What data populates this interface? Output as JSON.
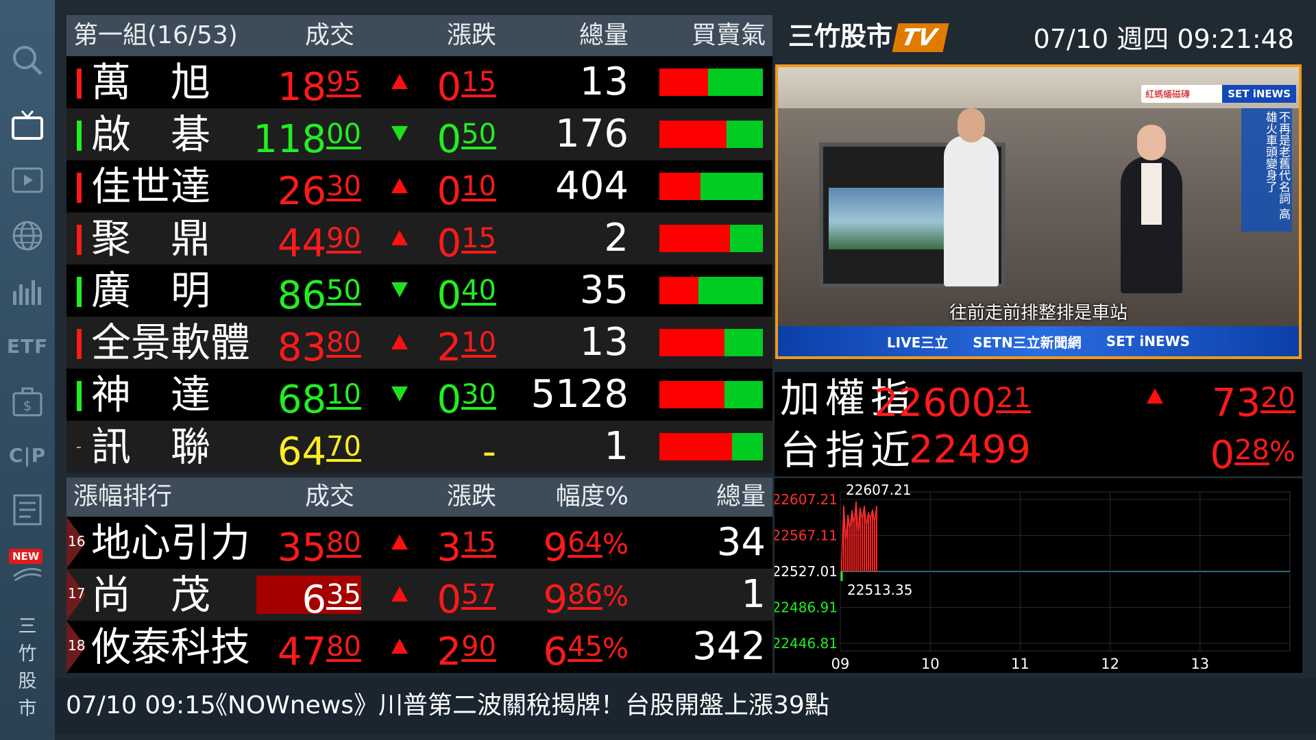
{
  "sidebar": {
    "items": [
      "search-icon",
      "tv-icon",
      "play-icon",
      "globe-icon",
      "chart-bars-icon",
      "ETF",
      "briefcase-dollar-icon",
      "C|P",
      "document-icon",
      "new-feature-icon"
    ],
    "etf_label": "ETF",
    "cp_label": "C|P",
    "new_badge": "NEW",
    "vertical_title": [
      "三",
      "竹",
      "股",
      "市"
    ]
  },
  "watchlist": {
    "headers": {
      "name": "第一組(16/53)",
      "price": "成交",
      "change": "漲跌",
      "volume": "總量",
      "sentiment": "買賣氣"
    },
    "rows": [
      {
        "name": "萬　旭",
        "price_int": "18",
        "price_dec": "95",
        "dir": "up",
        "chg_int": "0",
        "chg_dec": "15",
        "volume": "13",
        "buy_ratio": 47,
        "color": "red"
      },
      {
        "name": "啟　碁",
        "price_int": "118",
        "price_dec": "00",
        "dir": "down",
        "chg_int": "0",
        "chg_dec": "50",
        "volume": "176",
        "buy_ratio": 65,
        "color": "green"
      },
      {
        "name": "佳世達",
        "price_int": "26",
        "price_dec": "30",
        "dir": "up",
        "chg_int": "0",
        "chg_dec": "10",
        "volume": "404",
        "buy_ratio": 40,
        "color": "red"
      },
      {
        "name": "聚　鼎",
        "price_int": "44",
        "price_dec": "90",
        "dir": "up",
        "chg_int": "0",
        "chg_dec": "15",
        "volume": "2",
        "buy_ratio": 68,
        "color": "red"
      },
      {
        "name": "廣　明",
        "price_int": "86",
        "price_dec": "50",
        "dir": "down",
        "chg_int": "0",
        "chg_dec": "40",
        "volume": "35",
        "buy_ratio": 38,
        "color": "green"
      },
      {
        "name": "全景軟體",
        "price_int": "83",
        "price_dec": "80",
        "dir": "up",
        "chg_int": "2",
        "chg_dec": "10",
        "volume": "13",
        "buy_ratio": 63,
        "color": "red"
      },
      {
        "name": "神　達",
        "price_int": "68",
        "price_dec": "10",
        "dir": "down",
        "chg_int": "0",
        "chg_dec": "30",
        "volume": "5128",
        "buy_ratio": 63,
        "color": "green"
      },
      {
        "name": "訊　聯",
        "price_int": "64",
        "price_dec": "70",
        "dir": "none",
        "chg_int": "-",
        "chg_dec": "",
        "volume": "1",
        "buy_ratio": 70,
        "color": "yellow"
      }
    ]
  },
  "ranking": {
    "headers": {
      "name": "漲幅排行",
      "price": "成交",
      "change": "漲跌",
      "pct": "幅度%",
      "volume": "總量"
    },
    "rows": [
      {
        "rank": "16",
        "name": "地心引力",
        "price_int": "35",
        "price_dec": "80",
        "chg_int": "3",
        "chg_dec": "15",
        "pct_int": "9",
        "pct_dec": "64",
        "pct_sym": "%",
        "volume": "34",
        "highlight": false
      },
      {
        "rank": "17",
        "name": "尚　茂",
        "price_int": "6",
        "price_dec": "35",
        "chg_int": "0",
        "chg_dec": "57",
        "pct_int": "9",
        "pct_dec": "86",
        "pct_sym": "%",
        "volume": "1",
        "highlight": true
      },
      {
        "rank": "18",
        "name": "攸泰科技",
        "price_int": "47",
        "price_dec": "80",
        "chg_int": "2",
        "chg_dec": "90",
        "pct_int": "6",
        "pct_dec": "45",
        "pct_sym": "%",
        "volume": "342",
        "highlight": false
      }
    ]
  },
  "header": {
    "brand": "三竹股市",
    "brand_tv": "TV",
    "datetime": "07/10 週四 09:21:48"
  },
  "video": {
    "top_logo_left": "紅螞蟻磁磚",
    "top_logo_right": "SET iNEWS",
    "side_caption": "不再是老舊代名詞 高雄火車頭變身了",
    "subtitle": "往前走前排整排是車站",
    "bottom_bar": [
      "LIVE三立",
      "SETN三立新聞網",
      "SET iNEWS"
    ]
  },
  "indices": [
    {
      "name": "加權指",
      "val_int": "22600",
      "val_dec": "21",
      "dir": "up",
      "chg_int": "73",
      "chg_dec": "20",
      "chg_sym": ""
    },
    {
      "name": "台指近",
      "val_int": "22499",
      "val_dec": "",
      "dir": "none",
      "chg_int": "0",
      "chg_dec": "28",
      "chg_sym": "%"
    }
  ],
  "chart_data": {
    "type": "line",
    "y_ticks": [
      "22607.21",
      "22567.11",
      "22527.01",
      "22486.91",
      "22446.81"
    ],
    "ylim": [
      22446.81,
      22607.21
    ],
    "reference": 22527.01,
    "x_ticks": [
      "09",
      "10",
      "11",
      "12",
      "13"
    ],
    "high_label": "22607.21",
    "low_label": "22513.35",
    "series_index_sample": [
      22540,
      22600,
      22560,
      22590,
      22575,
      22595,
      22580,
      22605,
      22570,
      22598,
      22585,
      22600,
      22578,
      22592,
      22586,
      22596,
      22582,
      22600
    ],
    "grid": true
  },
  "ticker": {
    "time": "07/10 09:15",
    "headline": "《NOWnews》川普第二波關稅揭牌！台股開盤上漲39點"
  }
}
